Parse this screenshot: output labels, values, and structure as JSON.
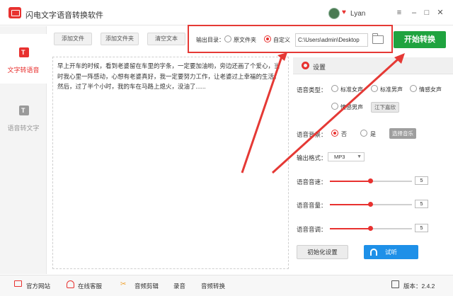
{
  "app": {
    "title": "闪电文字语音转换软件",
    "user": "Lyan"
  },
  "window": {
    "minimize": "–",
    "maximize": "□",
    "close": "✕",
    "menu": "≡"
  },
  "sidebar": {
    "items": [
      {
        "label": "文字转语音",
        "active": true
      },
      {
        "label": "语音转文字",
        "active": false
      }
    ]
  },
  "toolbar": {
    "add_file": "添加文件",
    "add_folder": "添加文件夹",
    "clear_text": "清空文本",
    "output_label": "输出目录：",
    "option_original": "原文件夹",
    "option_custom": "自定义",
    "path_value": "C:\\Users\\admin\\Desktop",
    "start_label": "开始转换"
  },
  "text_content": "早上开车的时候，看到老婆留在车里的字条，一定要加油哟，旁边还画了个爱心，当时我心里一阵感动，心想有老婆真好，我一定要努力工作，让老婆过上幸福的生活。然后，过了半个小时，我的车在马路上熄火，没油了......",
  "settings": {
    "title": "设置",
    "voice_type_label": "语音类型：",
    "voice_options": [
      "标准女声",
      "标准男声",
      "情感女声",
      "情感男声"
    ],
    "voice_tag": "江下嘉欣",
    "background_label": "语音背景：",
    "background_options": [
      "否",
      "是"
    ],
    "choose_music": "选择音乐",
    "format_label": "输出格式：",
    "format_value": "MP3",
    "speed_label": "语音音速：",
    "speed_value": "5",
    "volume_label": "语音音量：",
    "volume_value": "5",
    "pitch_label": "语音音调：",
    "pitch_value": "5",
    "slider_fraction": 0.5,
    "init_label": "初始化设置",
    "listen_label": "试听"
  },
  "footer": {
    "website": "官方网站",
    "support": "在线客服",
    "audio_edit": "音频剪辑",
    "record": "录音",
    "audio_convert": "音频转换",
    "version": "版本：2.4.2"
  },
  "colors": {
    "accent": "#e8312f",
    "start": "#1fa33f",
    "listen": "#1e90e8"
  }
}
